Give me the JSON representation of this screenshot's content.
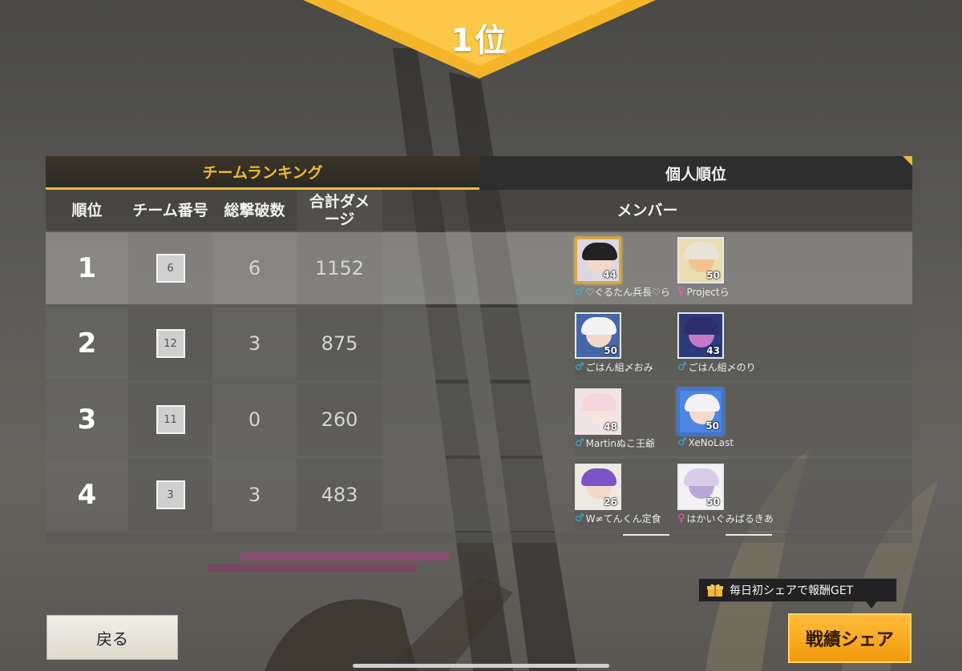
{
  "result": {
    "rank_label": "1位"
  },
  "tabs": [
    {
      "label": "チームランキング",
      "active": true
    },
    {
      "label": "個人順位",
      "active": false
    }
  ],
  "columns": {
    "rank": "順位",
    "team": "チーム番号",
    "kills": "総撃破数",
    "damage": "合計ダメージ",
    "members": "メンバー"
  },
  "rows": [
    {
      "rank": "1",
      "team": "6",
      "kills": "6",
      "damage": "1152",
      "highlight": true,
      "members": [
        {
          "name": "♡ぐるたん兵長♡ら",
          "gender": "♂",
          "level": "44",
          "frame": "gold",
          "hair": "#222",
          "face": "#f3d9c9"
        },
        {
          "name": "Projectら",
          "gender": "♀",
          "level": "50",
          "frame": "none",
          "hair": "#e9e3d4",
          "face": "#f1c48f"
        }
      ]
    },
    {
      "rank": "2",
      "team": "12",
      "kills": "3",
      "damage": "875",
      "highlight": false,
      "members": [
        {
          "name": "ごはん組〆おみ",
          "gender": "♂",
          "level": "50",
          "frame": "none",
          "hair": "#f2f2f5",
          "face": "#f3d9c9"
        },
        {
          "name": "ごはん組〆のり",
          "gender": "♂",
          "level": "43",
          "frame": "none",
          "hair": "#2b2f6e",
          "face": "#c57ac9"
        }
      ]
    },
    {
      "rank": "3",
      "team": "11",
      "kills": "0",
      "damage": "260",
      "highlight": false,
      "members": [
        {
          "name": "Martinぬこ王爺",
          "gender": "♂",
          "level": "48",
          "frame": "none",
          "hair": "#f5d6dc",
          "face": "#f6e5dc"
        },
        {
          "name": "XeNoLast",
          "gender": "♂",
          "level": "50",
          "frame": "blue",
          "hair": "#f2f2f5",
          "face": "#f3d9c9"
        }
      ]
    },
    {
      "rank": "4",
      "team": "3",
      "kills": "3",
      "damage": "483",
      "highlight": false,
      "members": [
        {
          "name": "W≠てんくん定食",
          "gender": "♂",
          "level": "26",
          "frame": "none",
          "hair": "#7a55c8",
          "face": "#f3d9c9"
        },
        {
          "name": "はかいぐみぱるきあ",
          "gender": "♀",
          "level": "50",
          "frame": "none",
          "hair": "#d7cde8",
          "face": "#b9a6d6"
        }
      ]
    }
  ],
  "buttons": {
    "back": "戻る",
    "share": "戦績シェア",
    "share_tip": "毎日初シェアで報酬GET"
  },
  "colors": {
    "accent": "#f1b736",
    "male": "#2fb3e8",
    "female": "#e85fb3"
  }
}
